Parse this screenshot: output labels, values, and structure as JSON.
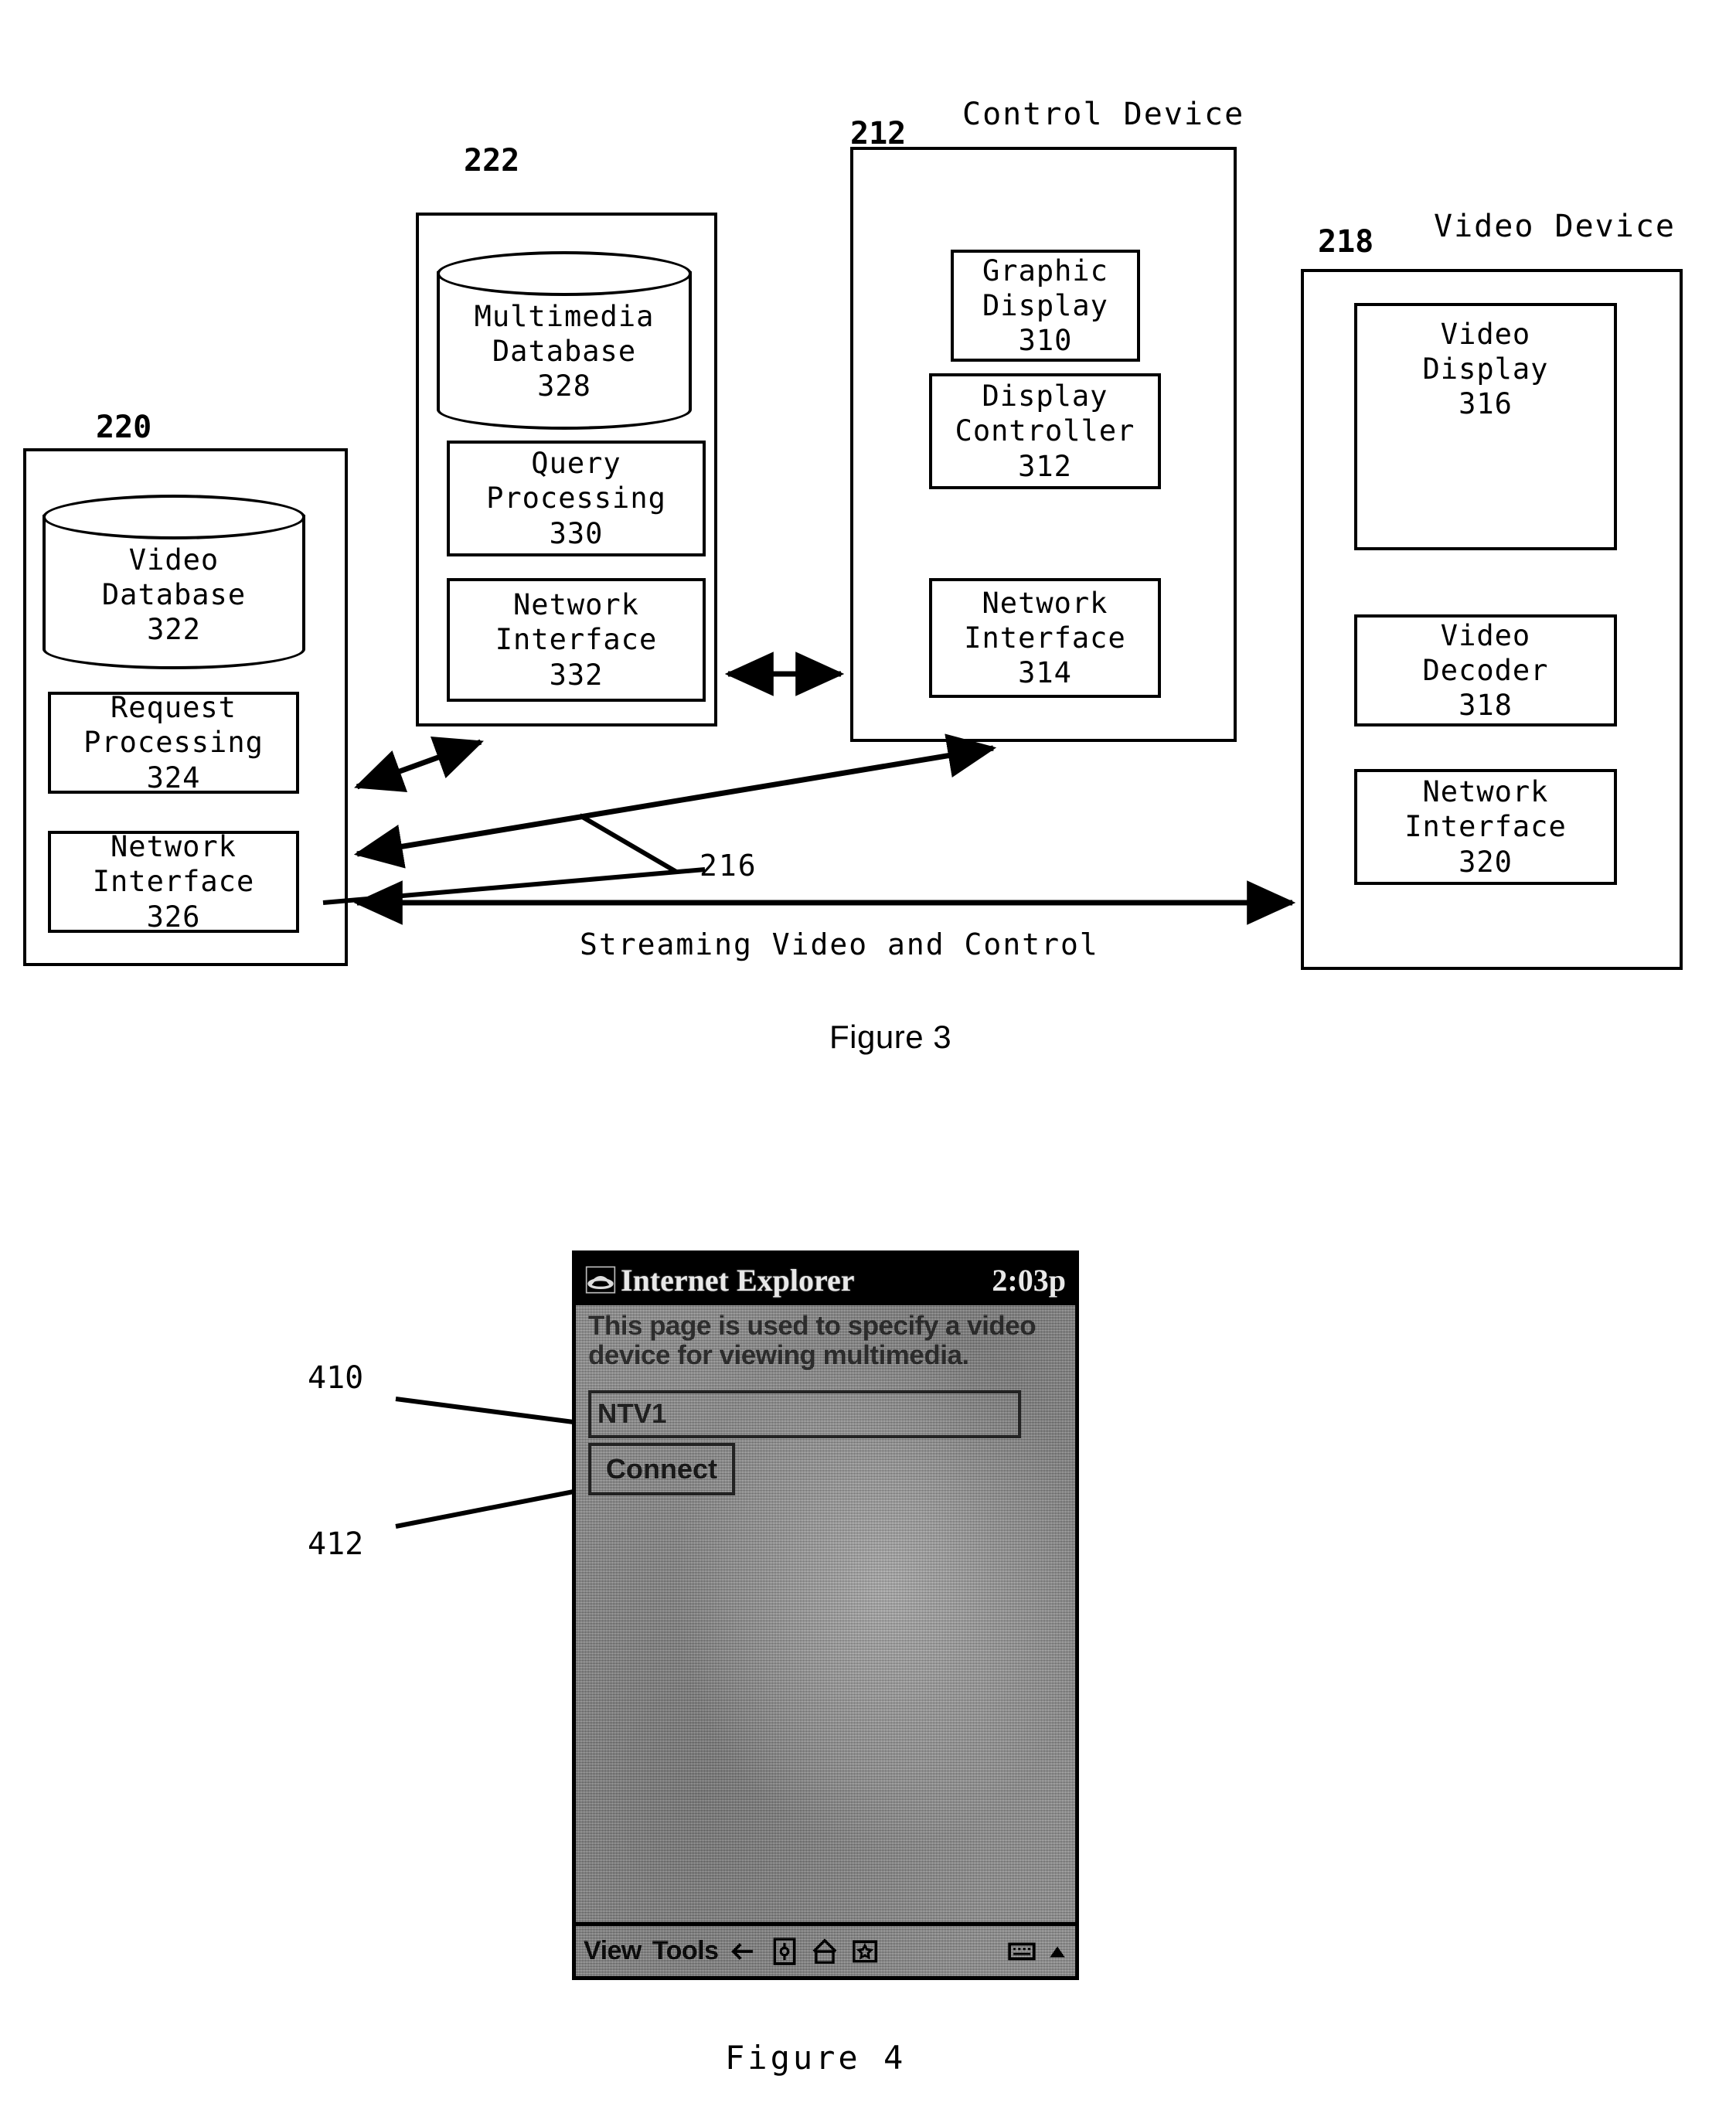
{
  "figure3": {
    "caption": "Figure 3",
    "link_label_216": "216",
    "link_label_text": "Streaming Video and Control",
    "nodes": [
      {
        "ref": "220",
        "title": "",
        "db": {
          "name": "Video\nDatabase",
          "num": "322"
        },
        "modules": [
          {
            "name": "Request\nProcessing",
            "num": "324"
          },
          {
            "name": "Network\nInterface",
            "num": "326"
          }
        ]
      },
      {
        "ref": "222",
        "title": "",
        "db": {
          "name": "Multimedia\nDatabase",
          "num": "328"
        },
        "modules": [
          {
            "name": "Query\nProcessing",
            "num": "330"
          },
          {
            "name": "Network\nInterface",
            "num": "332"
          }
        ]
      },
      {
        "ref": "212",
        "title": "Control Device",
        "db": null,
        "modules": [
          {
            "name": "Graphic\nDisplay",
            "num": "310"
          },
          {
            "name": "Display\nController",
            "num": "312"
          },
          {
            "name": "Network\nInterface",
            "num": "314"
          }
        ]
      },
      {
        "ref": "218",
        "title": "Video Device",
        "db": null,
        "modules": [
          {
            "name": "Video\nDisplay",
            "num": "316"
          },
          {
            "name": "Video\nDecoder",
            "num": "318"
          },
          {
            "name": "Network\nInterface",
            "num": "320"
          }
        ]
      }
    ],
    "box_220": {
      "ref": "220",
      "db_line1": "Video",
      "db_line2": "Database",
      "db_num": "322",
      "m1_line1": "Request",
      "m1_line2": "Processing",
      "m1_num": "324",
      "m2_line1": "Network",
      "m2_line2": "Interface",
      "m2_num": "326"
    },
    "box_222": {
      "ref": "222",
      "db_line1": "Multimedia",
      "db_line2": "Database",
      "db_num": "328",
      "m1_line1": "Query",
      "m1_line2": "Processing",
      "m1_num": "330",
      "m2_line1": "Network",
      "m2_line2": "Interface",
      "m2_num": "332"
    },
    "box_212": {
      "ref": "212",
      "title": "Control Device",
      "m1_line1": "Graphic",
      "m1_line2": "Display",
      "m1_num": "310",
      "m2_line1": "Display",
      "m2_line2": "Controller",
      "m2_num": "312",
      "m3_line1": "Network",
      "m3_line2": "Interface",
      "m3_num": "314"
    },
    "box_218": {
      "ref": "218",
      "title": "Video Device",
      "m1_line1": "Video",
      "m1_line2": "Display",
      "m1_num": "316",
      "m2_line1": "Video",
      "m2_line2": "Decoder",
      "m2_num": "318",
      "m3_line1": "Network",
      "m3_line2": "Interface",
      "m3_num": "320"
    }
  },
  "figure4": {
    "caption": "Figure 4",
    "callout_410": "410",
    "callout_412": "412",
    "device": {
      "titlebar": {
        "app_name": "Internet Explorer",
        "clock": "2:03p"
      },
      "page_text": "This page is used to specify a video device for viewing multimedia.",
      "address_field": {
        "value": "NTV1",
        "placeholder": ""
      },
      "connect_button": "Connect",
      "toolbar": {
        "view_label": "View",
        "tools_label": "Tools",
        "icons": [
          "back-arrow-icon",
          "refresh-icon",
          "home-icon",
          "favorites-icon",
          "keyboard-icon",
          "chevron-up-icon"
        ]
      }
    }
  },
  "colors": {
    "ink": "#000000",
    "screen_gray": "#9a9a9a",
    "titlebar": "#000000"
  }
}
